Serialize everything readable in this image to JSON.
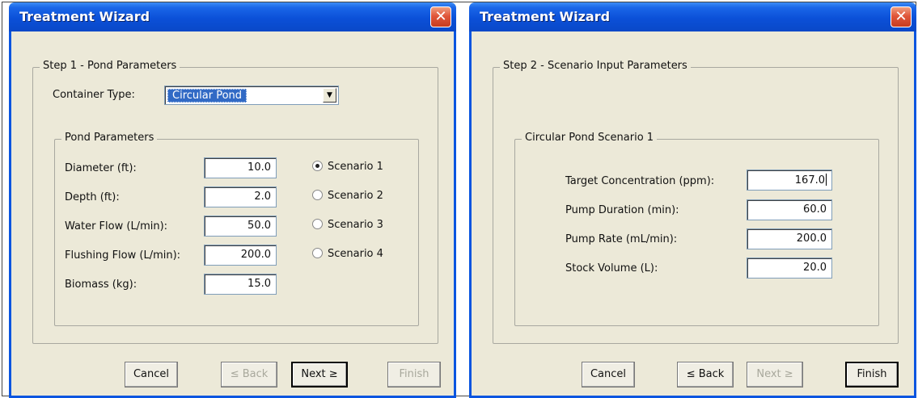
{
  "left_dialog": {
    "title": "Treatment Wizard",
    "close_label": "✕",
    "step_group": "Step 1 - Pond Parameters",
    "container_type_label": "Container Type:",
    "container_type_value": "Circular Pond",
    "combo_arrow": "▼",
    "pond_group": "Pond Parameters",
    "fields": [
      {
        "label": "Diameter (ft):",
        "value": "10.0"
      },
      {
        "label": "Depth (ft):",
        "value": "2.0"
      },
      {
        "label": "Water Flow (L/min):",
        "value": "50.0"
      },
      {
        "label": "Flushing Flow (L/min):",
        "value": "200.0"
      },
      {
        "label": "Biomass (kg):",
        "value": "15.0"
      }
    ],
    "scenarios": [
      {
        "label": "Scenario 1",
        "checked": true
      },
      {
        "label": "Scenario 2",
        "checked": false
      },
      {
        "label": "Scenario 3",
        "checked": false
      },
      {
        "label": "Scenario 4",
        "checked": false
      }
    ],
    "buttons": {
      "cancel": "Cancel",
      "back": "≤ Back",
      "next": "Next ≥",
      "finish": "Finish"
    }
  },
  "right_dialog": {
    "title": "Treatment Wizard",
    "close_label": "✕",
    "step_group": "Step 2 - Scenario Input Parameters",
    "scenario_group": "Circular Pond Scenario 1",
    "fields": [
      {
        "label": "Target Concentration (ppm):",
        "value": "167.0"
      },
      {
        "label": "Pump Duration (min):",
        "value": "60.0"
      },
      {
        "label": "Pump Rate (mL/min):",
        "value": "200.0"
      },
      {
        "label": "Stock Volume (L):",
        "value": "20.0"
      }
    ],
    "buttons": {
      "cancel": "Cancel",
      "back": "≤ Back",
      "next": "Next ≥",
      "finish": "Finish"
    }
  },
  "colors": {
    "titlebar": "#0b50d8",
    "dialog_bg": "#ece9d8",
    "selection": "#316ac5",
    "close_button": "#e0563a"
  }
}
